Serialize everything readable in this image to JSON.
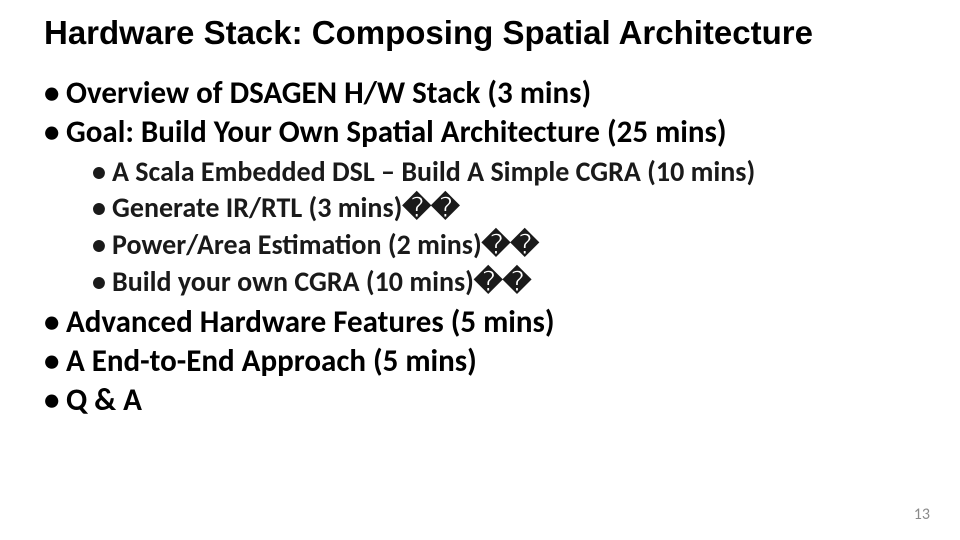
{
  "title": "Hardware Stack: Composing Spatial Architecture",
  "bullets": {
    "b1": "Overview of DSAGEN H/W Stack (3 mins)",
    "b2": "Goal: Build Your Own Spatial Architecture (25 mins)",
    "b2_1": "A Scala Embedded DSL – Build A Simple CGRA (10 mins)",
    "b2_2": "Generate IR/RTL (3 mins)��",
    "b2_3": "Power/Area Estimation (2 mins)��",
    "b2_4": "Build your own CGRA (10 mins)��",
    "b3": "Advanced Hardware Features (5 mins)",
    "b4": "A End-to-End Approach (5 mins)",
    "b5": "Q & A"
  },
  "page_number": "13"
}
